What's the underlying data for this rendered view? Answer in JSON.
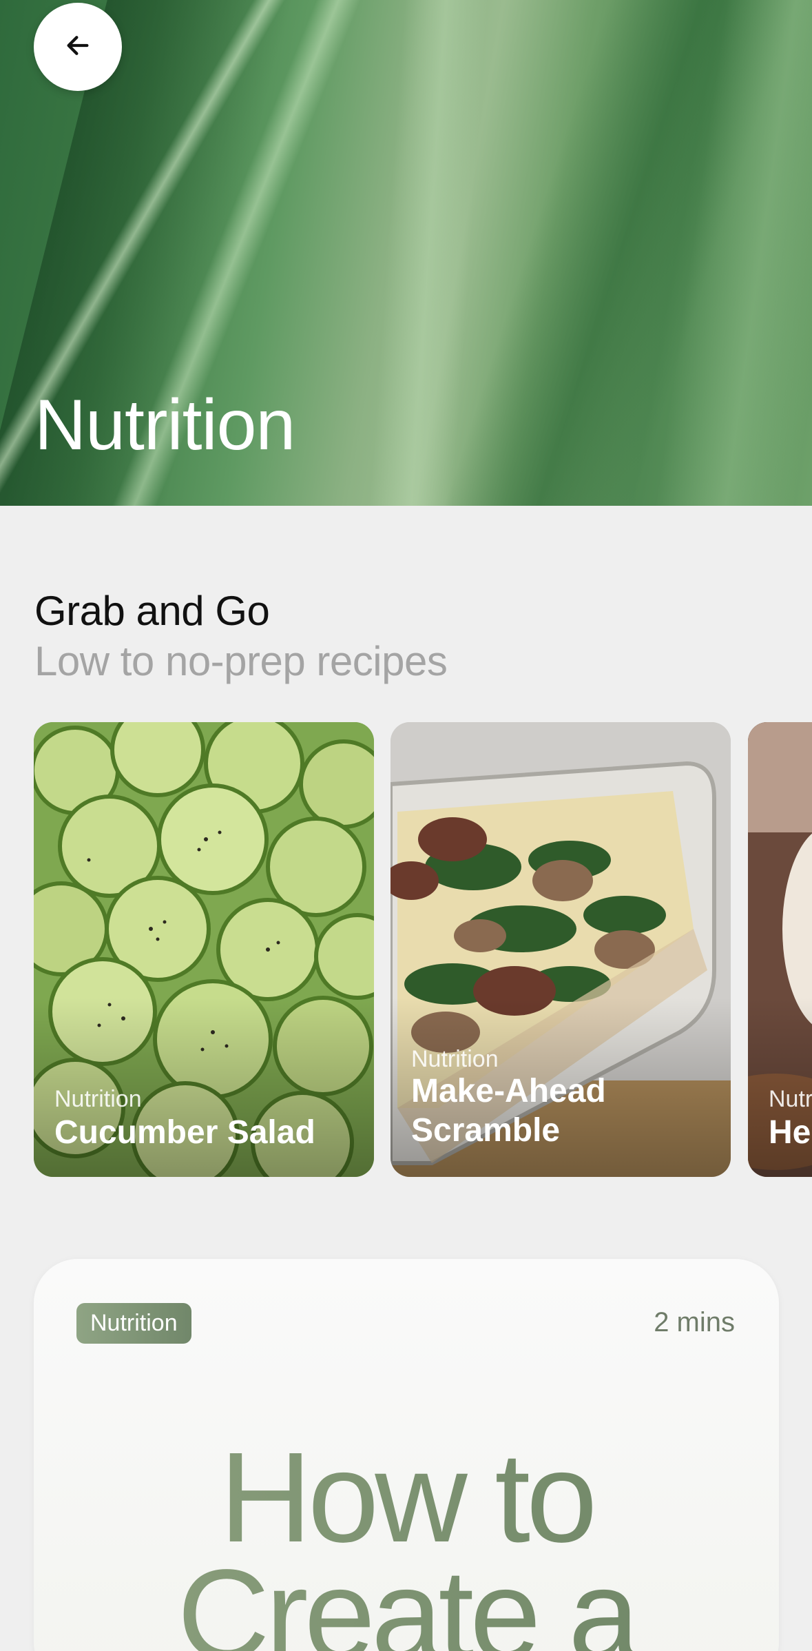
{
  "hero": {
    "title": "Nutrition"
  },
  "section": {
    "title": "Grab and Go",
    "subtitle": "Low to no-prep recipes"
  },
  "recipes": [
    {
      "category": "Nutrition",
      "name": "Cucumber Salad"
    },
    {
      "category": "Nutrition",
      "name": "Make-Ahead Scramble"
    },
    {
      "category": "Nutrition",
      "name": "He"
    }
  ],
  "article": {
    "tag": "Nutrition",
    "read_time": "2 mins",
    "title": "How to Create a"
  },
  "colors": {
    "accent_green": "#71876a",
    "background": "#efefef"
  },
  "icons": {
    "back": "arrow-left-icon"
  }
}
